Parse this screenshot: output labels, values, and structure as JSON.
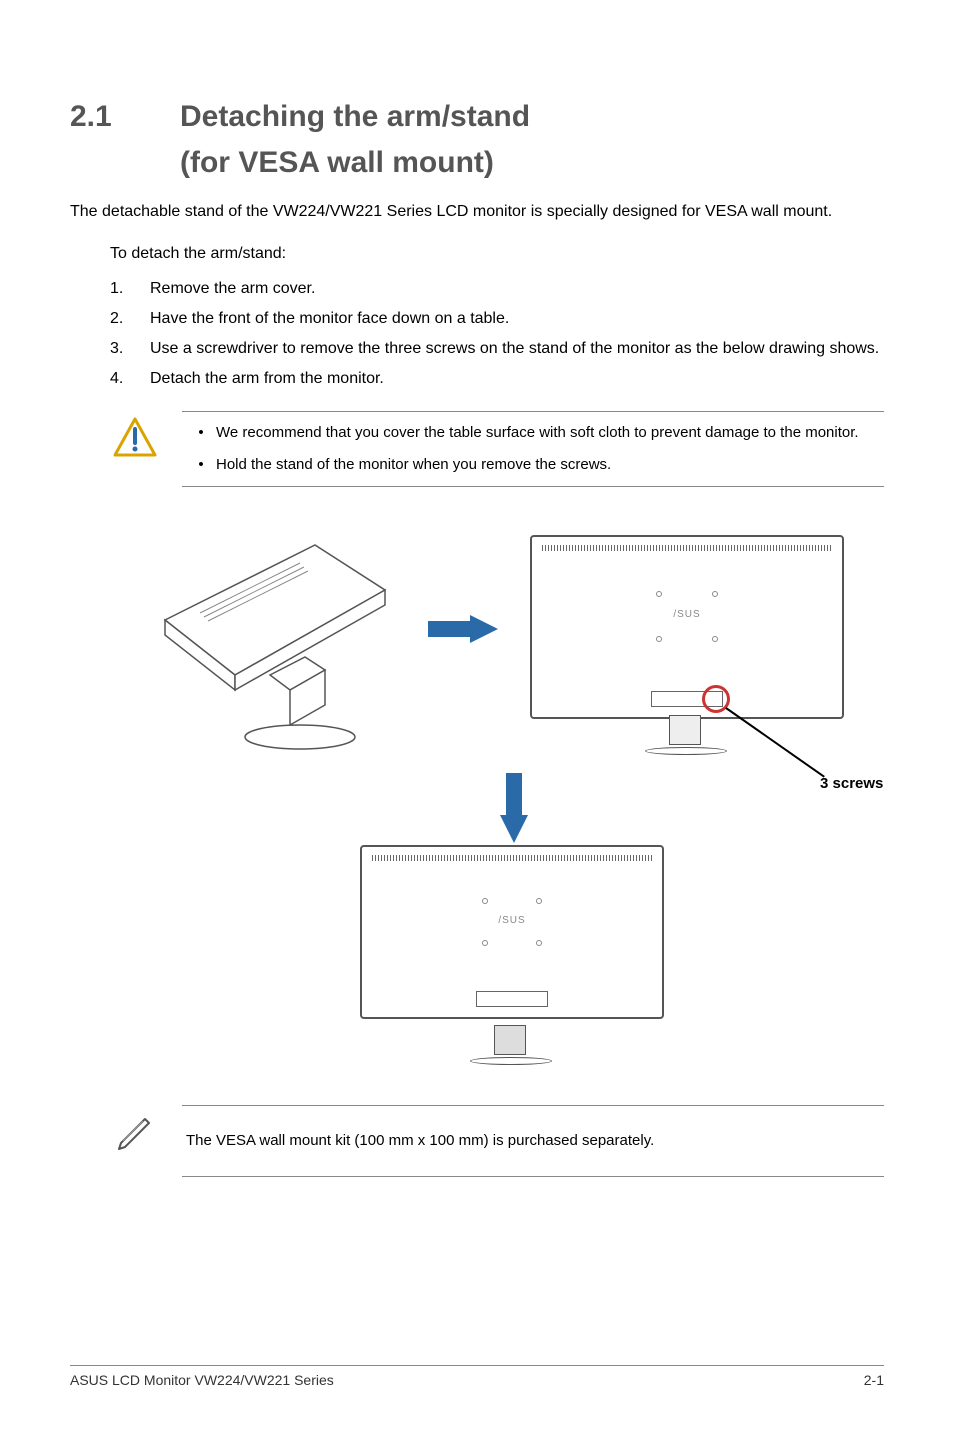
{
  "section_number": "2.1",
  "title_line1": "Detaching the arm/stand",
  "title_line2": "(for VESA wall mount)",
  "intro": "The detachable stand of the VW224/VW221 Series LCD monitor is specially designed for VESA wall mount.",
  "subheading": "To detach the arm/stand:",
  "steps": [
    "Remove the arm cover.",
    "Have the front of the monitor face down on a table.",
    "Use a screwdriver to remove the three screws on the stand of the monitor as the below drawing shows.",
    "Detach the arm from the monitor."
  ],
  "caution_notes": [
    "We recommend that you cover the table surface with soft cloth to prevent damage to the monitor.",
    "Hold the stand of the monitor when you remove the screws."
  ],
  "diagram": {
    "screw_label": "3 screws"
  },
  "info_note": "The VESA wall mount kit (100 mm x 100 mm) is purchased separately.",
  "footer_left": "ASUS LCD Monitor VW224/VW221 Series",
  "footer_right": "2-1"
}
